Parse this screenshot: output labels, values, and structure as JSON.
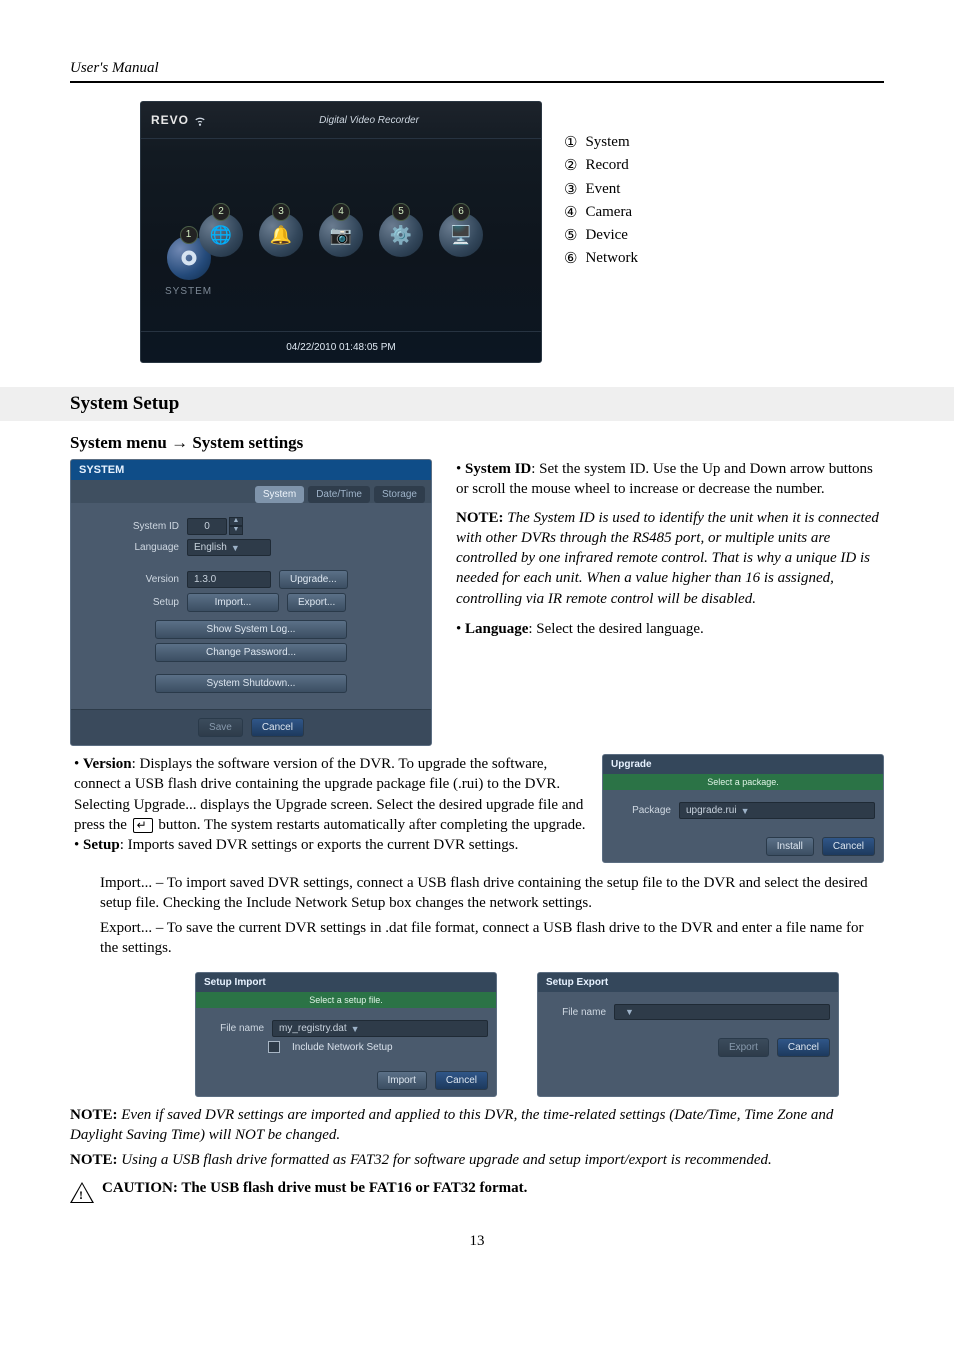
{
  "header": {
    "left": "User's Manual",
    "page_label": "13"
  },
  "dvr_menu": {
    "brand": "REVO",
    "title": "Digital Video Recorder",
    "timestamp": "04/22/2010  01:48:05 PM",
    "main_label": "SYSTEM",
    "main_badge": "1",
    "icons": [
      {
        "badge": "2",
        "name": "Record"
      },
      {
        "badge": "3",
        "name": "Event"
      },
      {
        "badge": "4",
        "name": "Camera"
      },
      {
        "badge": "5",
        "name": "Device"
      },
      {
        "badge": "6",
        "name": "Network"
      }
    ]
  },
  "legend": [
    {
      "num": "①",
      "label": "System"
    },
    {
      "num": "②",
      "label": "Record"
    },
    {
      "num": "③",
      "label": "Event"
    },
    {
      "num": "④",
      "label": "Camera"
    },
    {
      "num": "⑤",
      "label": "Device"
    },
    {
      "num": "⑥",
      "label": "Network"
    }
  ],
  "section_heading": "System Setup",
  "subheading_parts": {
    "a": "System menu ",
    "arrow": "→",
    "b": " System settings"
  },
  "system_panel": {
    "title": "SYSTEM",
    "tabs": {
      "system": "System",
      "datetime": "Date/Time",
      "storage": "Storage"
    },
    "rows": {
      "system_id_label": "System ID",
      "system_id_value": "0",
      "language_label": "Language",
      "language_value": "English",
      "version_label": "Version",
      "version_value": "1.3.0",
      "setup_label": "Setup"
    },
    "buttons": {
      "upgrade": "Upgrade...",
      "import": "Import...",
      "export": "Export...",
      "show_log": "Show System Log...",
      "change_pw": "Change Password...",
      "shutdown": "System Shutdown...",
      "save": "Save",
      "cancel": "Cancel"
    }
  },
  "desc": {
    "system_id": {
      "label": "System ID",
      "text": ":  Set the system ID.  Use the Up and Down arrow buttons or scroll the mouse wheel to increase or decrease the number."
    },
    "sysid_note_head": "NOTE:",
    "sysid_note": "The System ID is used to identify the unit when it is connected with other DVRs through the RS485 port, or multiple units are controlled by one infrared remote control. That is why a unique ID is needed for each unit. When a value higher than 16 is assigned, controlling via IR remote control will be disabled.",
    "language": {
      "label": "Language",
      "text": ":  Select the desired language."
    },
    "version": {
      "label": "Version",
      "text_a": ":  Displays the software version of the DVR.  To upgrade the software, connect a USB flash drive containing the upgrade package file (.rui) to the DVR.  Selecting ",
      "upgrade_word": "Upgrade...",
      "text_b": " displays the Upgrade screen.  Select the desired upgrade file and press the ",
      "text_c": " button.  The system restarts automatically after completing the upgrade."
    },
    "setup": {
      "label": "Setup",
      "text": ":  Imports saved DVR settings or exports the current DVR settings."
    },
    "import_line_a": "Import...",
    "import_line_b": " – To import saved DVR settings, connect a USB flash drive containing the setup file to the DVR and select the desired setup file.  Checking the ",
    "import_line_c": "Include Network Setup",
    "import_line_d": " box changes the network settings.",
    "export_line_a": "Export...",
    "export_line_b": " – To save the current DVR settings in ",
    "export_line_c": ".dat",
    "export_line_d": " file format, connect a USB flash drive to the DVR and enter a file name for the settings."
  },
  "upgrade_panel": {
    "title": "Upgrade",
    "info": "Select a package.",
    "package_label": "Package",
    "package_value": "upgrade.rui",
    "install": "Install",
    "cancel": "Cancel"
  },
  "import_panel": {
    "title": "Setup Import",
    "info": "Select a setup file.",
    "file_label": "File name",
    "file_value": "my_registry.dat",
    "include_label": "Include Network Setup",
    "import": "Import",
    "cancel": "Cancel"
  },
  "export_panel": {
    "title": "Setup Export",
    "file_label": "File name",
    "file_value": "",
    "export": "Export",
    "cancel": "Cancel"
  },
  "notes": {
    "note_head": "NOTE:",
    "note1": "Even if saved DVR settings are imported and applied to this DVR, the time-related settings (Date/Time, Time Zone and Daylight Saving Time) will NOT be changed.",
    "note2": "Using a USB flash drive formatted as FAT32 for software upgrade and setup import/export is recommended.",
    "caution_head": "CAUTION:",
    "caution": "  The USB flash drive must be FAT16 or FAT32 format."
  }
}
